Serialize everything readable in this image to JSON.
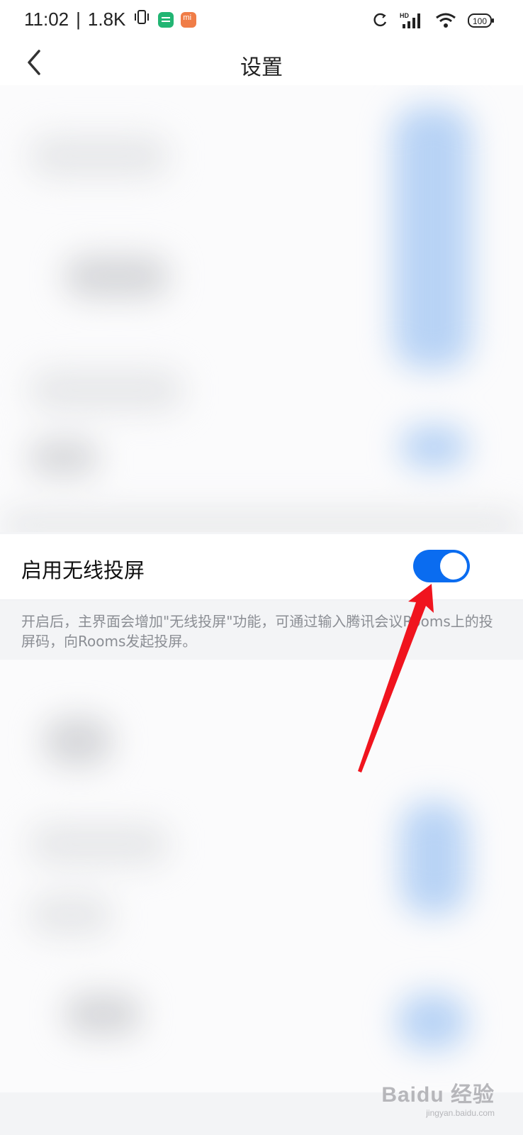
{
  "status_bar": {
    "time": "11:02",
    "network_speed": "1.8K",
    "network_badge": "HD",
    "battery": "100",
    "icons": [
      "vibrate-icon",
      "green-app-icon",
      "xiaomi-app-icon",
      "sync-icon",
      "signal-icon",
      "wifi-icon",
      "battery-icon"
    ]
  },
  "header": {
    "title": "设置",
    "back_icon": "chevron-left-icon"
  },
  "wireless_cast": {
    "label": "启用无线投屏",
    "enabled": true,
    "toggle_color": "#0a6cf0",
    "description": "开启后，主界面会增加\"无线投屏\"功能，可通过输入腾讯会议Rooms上的投屏码，向Rooms发起投屏。"
  },
  "watermark": {
    "brand": "Baidu 经验",
    "url": "jingyan.baidu.com"
  },
  "colors": {
    "accent": "#0a6cf0",
    "annotation_arrow": "#f0141e",
    "background": "#f3f4f6"
  }
}
